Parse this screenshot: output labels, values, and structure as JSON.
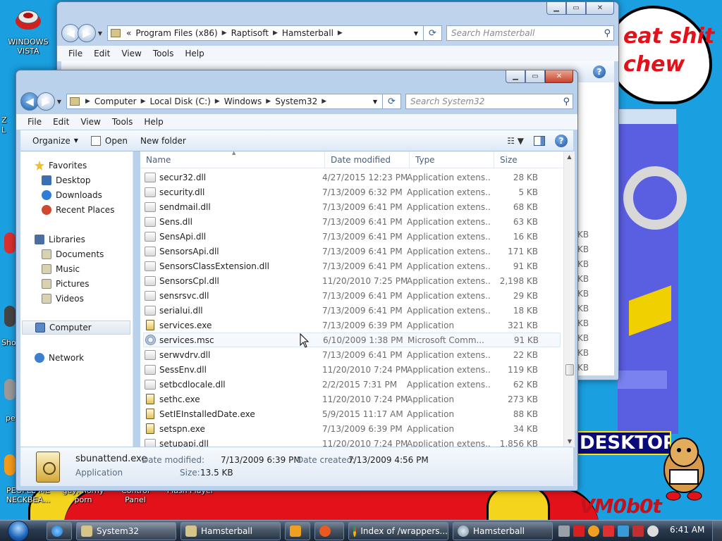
{
  "desktop": {
    "bubble_lines": [
      "eat shit",
      "chew"
    ],
    "banner": "DESKTOP",
    "watermark": "VM0b0t",
    "icons": [
      {
        "label": "WINDOWS VISTA"
      },
      {
        "label": "PEOPLE ME NECKBEA..."
      },
      {
        "label": "gay, horny porn"
      },
      {
        "label": "Control Panel"
      },
      {
        "label": "Flash Player"
      }
    ],
    "edge_labels": [
      "Z",
      "L",
      "Sho",
      "pe"
    ]
  },
  "back_window": {
    "path": [
      "Program Files (x86)",
      "Raptisoft",
      "Hamsterball"
    ],
    "path_prefix": "«",
    "search_placeholder": "Search Hamsterball",
    "menu": [
      "File",
      "Edit",
      "View",
      "Tools",
      "Help"
    ],
    "size_fragments": [
      "KB",
      "KB",
      "KB",
      "KB",
      "KB",
      "KB",
      "KB",
      "KB",
      "KB",
      "KB"
    ]
  },
  "front_window": {
    "path": [
      "Computer",
      "Local Disk (C:)",
      "Windows",
      "System32"
    ],
    "search_placeholder": "Search System32",
    "menu": [
      "File",
      "Edit",
      "View",
      "Tools",
      "Help"
    ],
    "toolbar": {
      "organize": "Organize",
      "open": "Open",
      "new_folder": "New folder"
    },
    "nav": {
      "favorites": "Favorites",
      "desktop": "Desktop",
      "downloads": "Downloads",
      "recent": "Recent Places",
      "libraries": "Libraries",
      "documents": "Documents",
      "music": "Music",
      "pictures": "Pictures",
      "videos": "Videos",
      "computer": "Computer",
      "network": "Network"
    },
    "columns": {
      "name": "Name",
      "date": "Date modified",
      "type": "Type",
      "size": "Size"
    },
    "files": [
      {
        "name": "secur32.dll",
        "date": "4/27/2015 12:23 PM",
        "type": "Application extens...",
        "size": "28 KB",
        "kind": "dll"
      },
      {
        "name": "security.dll",
        "date": "7/13/2009 6:32 PM",
        "type": "Application extens...",
        "size": "5 KB",
        "kind": "dll"
      },
      {
        "name": "sendmail.dll",
        "date": "7/13/2009 6:41 PM",
        "type": "Application extens...",
        "size": "68 KB",
        "kind": "dll"
      },
      {
        "name": "Sens.dll",
        "date": "7/13/2009 6:41 PM",
        "type": "Application extens...",
        "size": "63 KB",
        "kind": "dll"
      },
      {
        "name": "SensApi.dll",
        "date": "7/13/2009 6:41 PM",
        "type": "Application extens...",
        "size": "16 KB",
        "kind": "dll"
      },
      {
        "name": "SensorsApi.dll",
        "date": "7/13/2009 6:41 PM",
        "type": "Application extens...",
        "size": "171 KB",
        "kind": "dll"
      },
      {
        "name": "SensorsClassExtension.dll",
        "date": "7/13/2009 6:41 PM",
        "type": "Application extens...",
        "size": "91 KB",
        "kind": "dll"
      },
      {
        "name": "SensorsCpl.dll",
        "date": "11/20/2010 7:25 PM",
        "type": "Application extens...",
        "size": "2,198 KB",
        "kind": "dll"
      },
      {
        "name": "sensrsvc.dll",
        "date": "7/13/2009 6:41 PM",
        "type": "Application extens...",
        "size": "29 KB",
        "kind": "dll"
      },
      {
        "name": "serialui.dll",
        "date": "7/13/2009 6:41 PM",
        "type": "Application extens...",
        "size": "18 KB",
        "kind": "dll"
      },
      {
        "name": "services.exe",
        "date": "7/13/2009 6:39 PM",
        "type": "Application",
        "size": "321 KB",
        "kind": "exe"
      },
      {
        "name": "services.msc",
        "date": "6/10/2009 1:38 PM",
        "type": "Microsoft Comm...",
        "size": "91 KB",
        "kind": "msc"
      },
      {
        "name": "serwvdrv.dll",
        "date": "7/13/2009 6:41 PM",
        "type": "Application extens...",
        "size": "22 KB",
        "kind": "dll"
      },
      {
        "name": "SessEnv.dll",
        "date": "11/20/2010 7:24 PM",
        "type": "Application extens...",
        "size": "119 KB",
        "kind": "dll"
      },
      {
        "name": "setbcdlocale.dll",
        "date": "2/2/2015 7:31 PM",
        "type": "Application extens...",
        "size": "62 KB",
        "kind": "dll"
      },
      {
        "name": "sethc.exe",
        "date": "11/20/2010 7:24 PM",
        "type": "Application",
        "size": "273 KB",
        "kind": "exe"
      },
      {
        "name": "SetIEInstalledDate.exe",
        "date": "5/9/2015 11:17 AM",
        "type": "Application",
        "size": "88 KB",
        "kind": "exe"
      },
      {
        "name": "setspn.exe",
        "date": "7/13/2009 6:39 PM",
        "type": "Application",
        "size": "34 KB",
        "kind": "exe"
      },
      {
        "name": "setupapi.dll",
        "date": "11/20/2010 7:24 PM",
        "type": "Application extens...",
        "size": "1,856 KB",
        "kind": "dll"
      }
    ],
    "details": {
      "name": "sbunattend.exe",
      "type": "Application",
      "modified_label": "Date modified:",
      "modified": "7/13/2009 6:39 PM",
      "created_label": "Date created:",
      "created": "7/13/2009 4:56 PM",
      "size_label": "Size:",
      "size": "13.5 KB"
    }
  },
  "taskbar": {
    "buttons": [
      "System32",
      "Hamsterball",
      "Index of /wrappers...",
      "Hamsterball"
    ],
    "clock": "6:41 AM"
  },
  "colors": {
    "accent": "#1b62b6",
    "desktop": "#1a9fe0",
    "close": "#c7432c"
  }
}
